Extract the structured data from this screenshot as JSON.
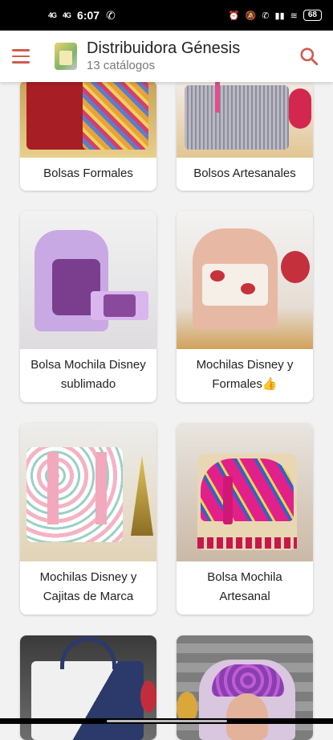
{
  "status": {
    "signal1": "4G",
    "signal2": "4G",
    "time": "6:07",
    "battery": "68"
  },
  "appbar": {
    "title": "Distribuidora Génesis",
    "subtitle": "13 catálogos"
  },
  "cards": [
    {
      "label": "Bolsas Formales"
    },
    {
      "label": "Bolsos Artesanales"
    },
    {
      "label": "Bolsa Mochila Disney sublimado"
    },
    {
      "label": "Mochilas Disney y Formales👍"
    },
    {
      "label": "Mochilas Disney y Cajitas de Marca"
    },
    {
      "label": "Bolsa Mochila Artesanal"
    },
    {
      "label": ""
    },
    {
      "label": ""
    }
  ]
}
